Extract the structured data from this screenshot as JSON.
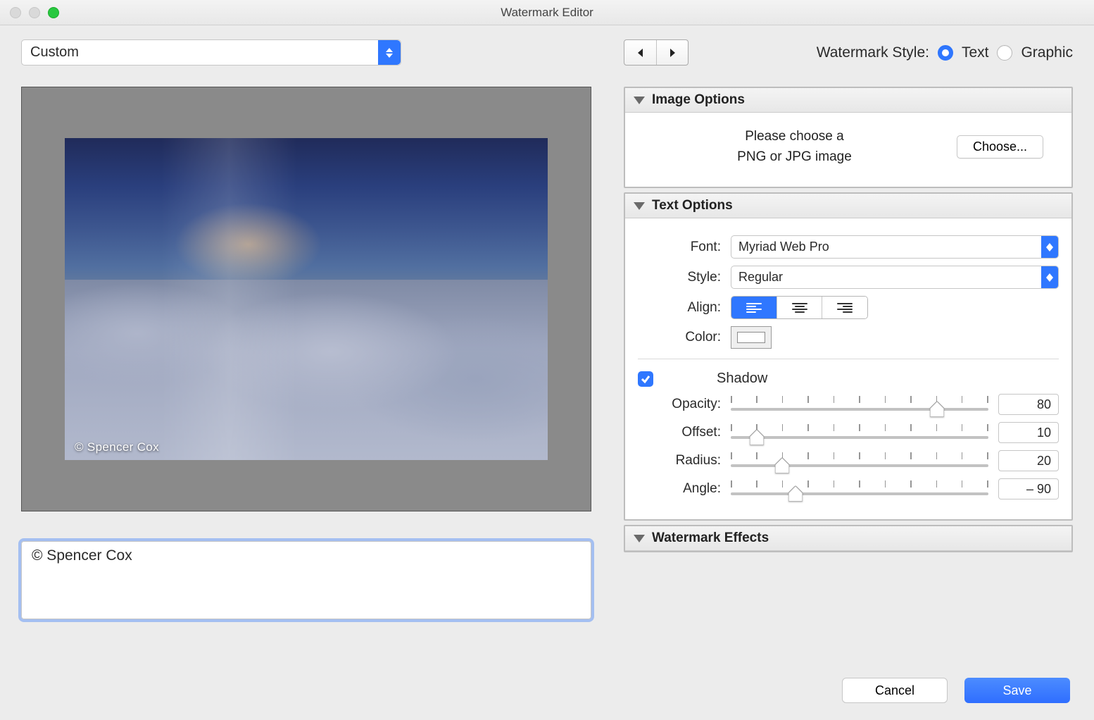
{
  "window_title": "Watermark Editor",
  "preset_select": "Custom",
  "watermark_style": {
    "label": "Watermark Style:",
    "options": {
      "text": "Text",
      "graphic": "Graphic"
    },
    "selected": "text"
  },
  "panels": {
    "image_options": {
      "title": "Image Options",
      "message_l1": "Please choose a",
      "message_l2": "PNG or JPG image",
      "choose_label": "Choose..."
    },
    "text_options": {
      "title": "Text Options",
      "font_label": "Font:",
      "font_value": "Myriad Web Pro",
      "style_label": "Style:",
      "style_value": "Regular",
      "align_label": "Align:",
      "color_label": "Color:",
      "shadow_label": "Shadow",
      "shadow_checked": true,
      "sliders": {
        "opacity": {
          "label": "Opacity:",
          "value": "80",
          "pos": 0.8
        },
        "offset": {
          "label": "Offset:",
          "value": "10",
          "pos": 0.1
        },
        "radius": {
          "label": "Radius:",
          "value": "20",
          "pos": 0.2
        },
        "angle": {
          "label": "Angle:",
          "value": "– 90",
          "pos": 0.25
        }
      }
    },
    "watermark_effects": {
      "title": "Watermark Effects"
    }
  },
  "watermark_text": "© Spencer Cox",
  "watermark_preview_text": "© Spencer Cox",
  "buttons": {
    "cancel": "Cancel",
    "save": "Save"
  }
}
